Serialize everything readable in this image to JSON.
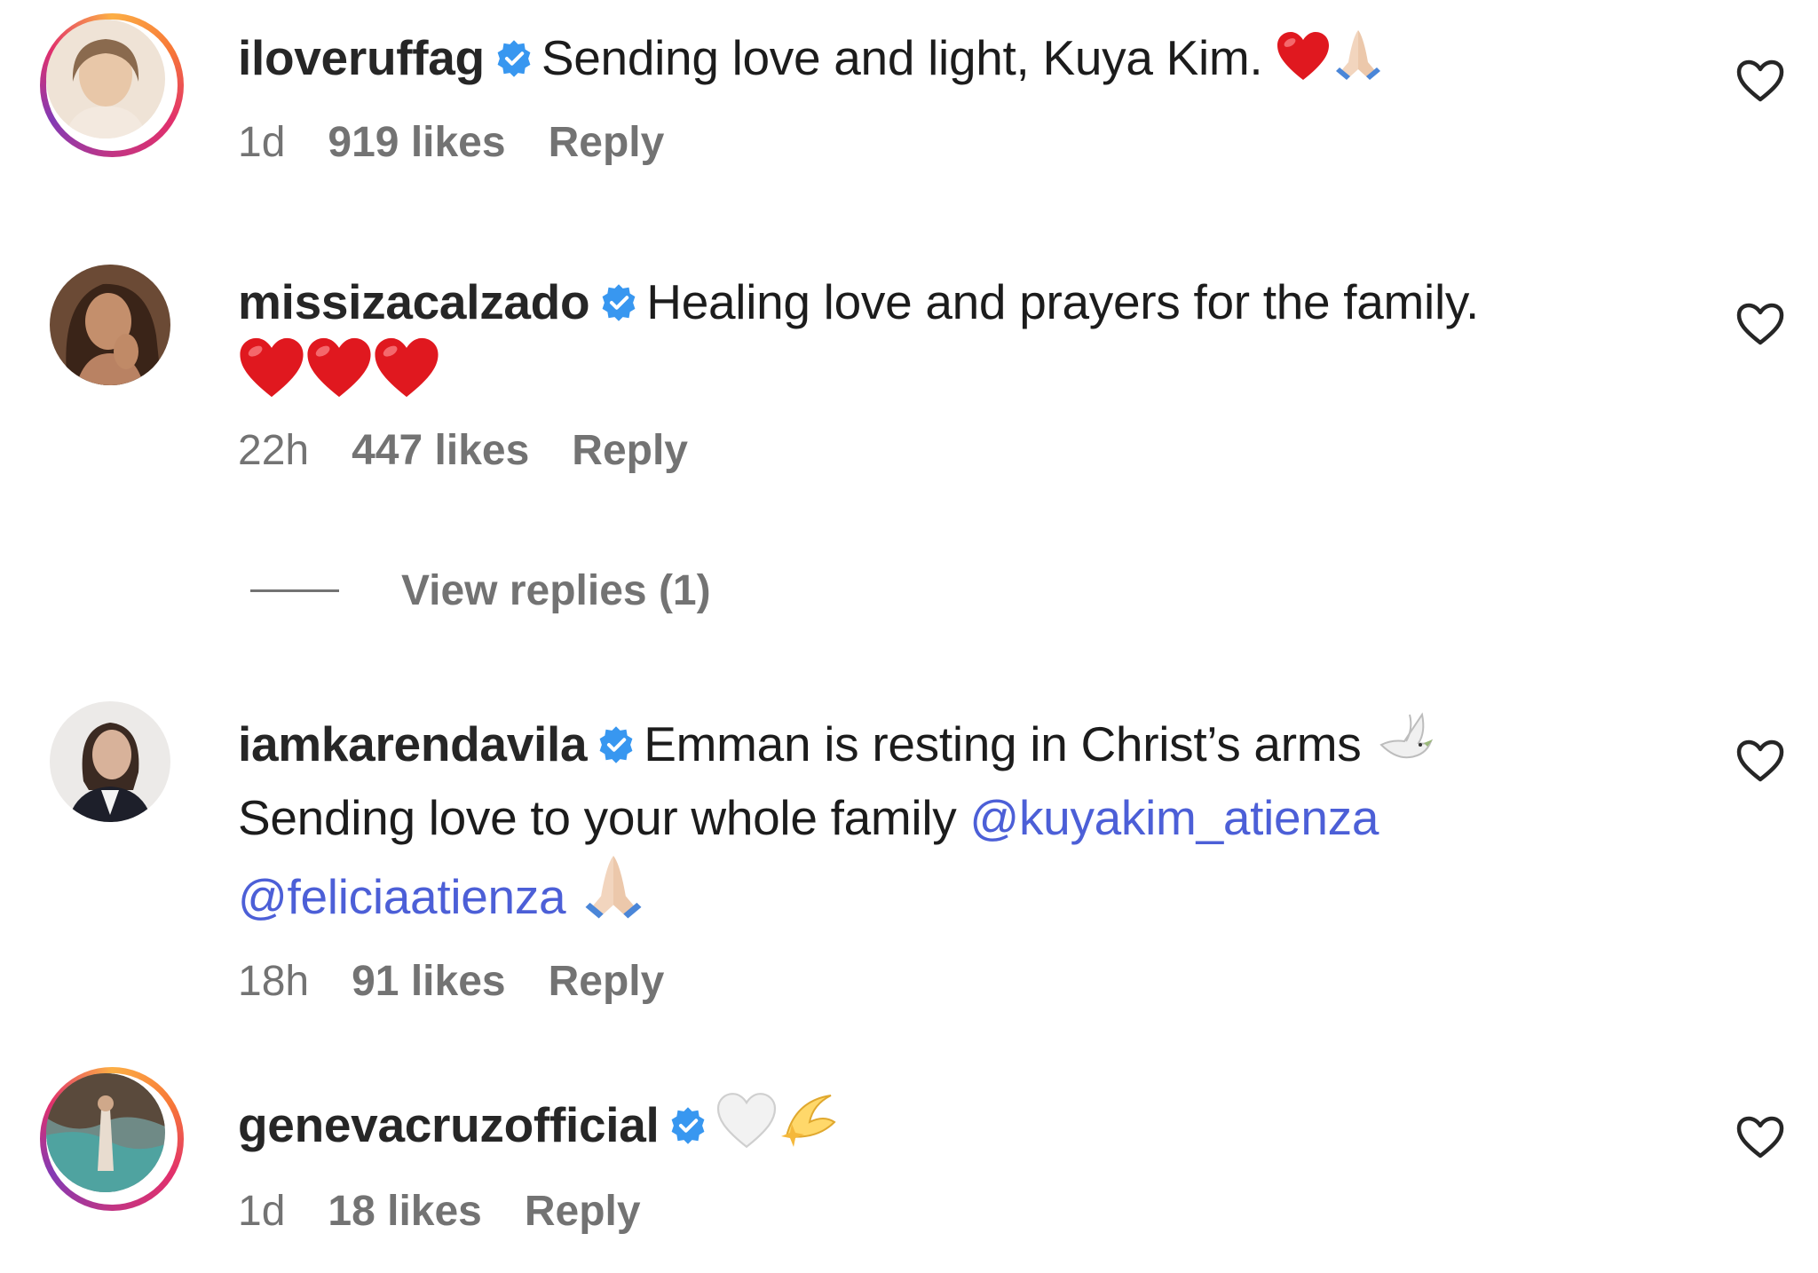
{
  "comments": [
    {
      "username": "iloveruffag",
      "verified": true,
      "text": "Sending love and light, Kuya Kim.",
      "emojis": [
        "red-heart",
        "folded-hands"
      ],
      "time": "1d",
      "likes": "919 likes",
      "reply": "Reply"
    },
    {
      "username": "missizacalzado",
      "verified": true,
      "text": "Healing love and prayers for the family.",
      "emojis": [
        "red-heart",
        "red-heart",
        "red-heart"
      ],
      "time": "22h",
      "likes": "447 likes",
      "reply": "Reply",
      "view_replies": "View replies (1)"
    },
    {
      "username": "iamkarendavila",
      "verified": true,
      "text_line1": "Emman is resting in Christ’s arms",
      "text_line2": "Sending love to your whole family",
      "mention1": "@kuyakim_atienza",
      "mention2": "@feliciaatienza",
      "emojis": [
        "dove",
        "folded-hands"
      ],
      "time": "18h",
      "likes": "91 likes",
      "reply": "Reply"
    },
    {
      "username": "genevacruzofficial",
      "verified": true,
      "emojis": [
        "white-heart",
        "dizzy"
      ],
      "time": "1d",
      "likes": "18 likes",
      "reply": "Reply"
    }
  ],
  "colors": {
    "mention": "#4c5fd7",
    "verified": "#3897f0",
    "meta": "#737373",
    "heart_emoji": "#e0181f"
  }
}
